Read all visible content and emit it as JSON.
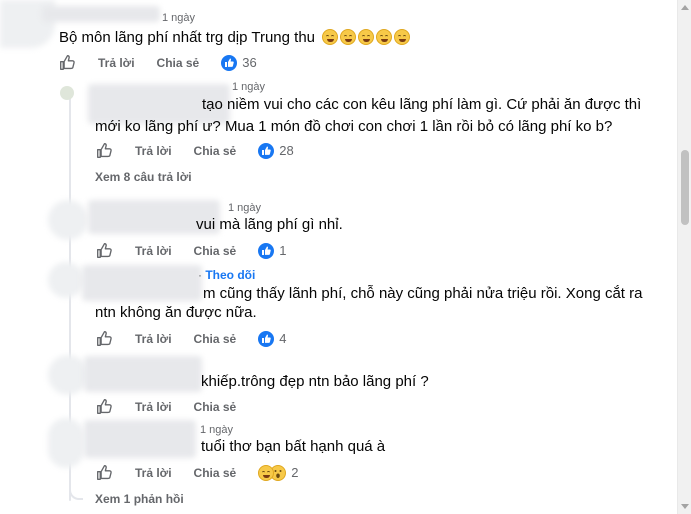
{
  "actions": {
    "reply": "Trả lời",
    "share": "Chia sẻ"
  },
  "comments": [
    {
      "time": "1 ngày",
      "text": "Bộ môn lãng phí nhất trg dịp Trung thu",
      "reaction_count": "36"
    },
    {
      "time": "1 ngày",
      "text_line1": "tạo niềm vui cho các con kêu lãng phí làm gì. Cứ phải ăn được thì",
      "text_line2": "mới ko lãng phí ư? Mua 1 món đồ chơi con chơi 1 lần rồi bỏ có lãng phí ko b?",
      "reaction_count": "28"
    },
    {
      "time": "1 ngày",
      "text": "vui mà lãng phí gì nhỉ.",
      "reaction_count": "1"
    },
    {
      "follow": "Theo dõi",
      "text_line1": "m cũng thấy lãnh phí, chỗ này cũng phải nửa triệu rồi. Xong cắt ra",
      "text_line2": "ntn không ăn được nữa.",
      "reaction_count": "4"
    },
    {
      "text": "khiếp.trông đẹp ntn bảo lãng phí ?"
    },
    {
      "time": "1 ngày",
      "text": "tuổi thơ bạn bất hạnh quá à",
      "reaction_count": "2"
    }
  ],
  "view_replies_1": "Xem 8 câu trả lời",
  "view_replies_2": "Xem 1 phản hồi",
  "colors": {
    "link": "#1877f2",
    "muted": "#65676b",
    "text": "#050505"
  },
  "icons": [
    "thumbs-up-outline-icon",
    "like-badge-icon",
    "grin-emoji-icon",
    "haha-emoji-icon",
    "wow-emoji-icon"
  ]
}
